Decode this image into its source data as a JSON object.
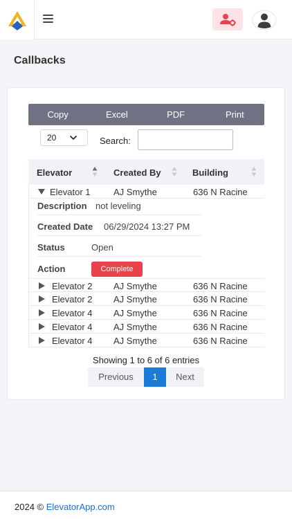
{
  "header": {
    "menu_icon": "hamburger-menu-icon",
    "admin_icon": "user-gear-icon",
    "profile_icon": "user-avatar-icon",
    "brand_colors": {
      "gold": "#f0b323",
      "blue": "#2563b8"
    }
  },
  "page": {
    "title": "Callbacks"
  },
  "toolbar": {
    "buttons": [
      "Copy",
      "Excel",
      "PDF",
      "Print"
    ],
    "length_value": "20",
    "search_label": "Search:",
    "search_value": ""
  },
  "table": {
    "columns": [
      "Elevator",
      "Created By",
      "Building"
    ],
    "expanded_row": {
      "elevator": "Elevator 1",
      "created_by": "AJ Smythe",
      "building": "636 N Racine"
    },
    "details": {
      "description_label": "Description",
      "description_value": "not leveling",
      "created_label": "Created Date",
      "created_value": "06/29/2024 13:27 PM",
      "status_label": "Status",
      "status_value": "Open",
      "action_label": "Action",
      "action_button": "Complete"
    },
    "rows": [
      {
        "elevator": "Elevator 2",
        "created_by": "AJ Smythe",
        "building": "636 N Racine"
      },
      {
        "elevator": "Elevator 2",
        "created_by": "AJ Smythe",
        "building": "636 N Racine"
      },
      {
        "elevator": "Elevator 4",
        "created_by": "AJ Smythe",
        "building": "636 N Racine"
      },
      {
        "elevator": "Elevator 4",
        "created_by": "AJ Smythe",
        "building": "636 N Racine"
      },
      {
        "elevator": "Elevator 4",
        "created_by": "AJ Smythe",
        "building": "636 N Racine"
      }
    ]
  },
  "pagination": {
    "info": "Showing 1 to 6 of 6 entries",
    "previous": "Previous",
    "current": "1",
    "next": "Next"
  },
  "footer": {
    "year": "2024 ©",
    "link": "ElevatorApp.com"
  },
  "colors": {
    "accent": "#1a7bd8",
    "danger": "#e9424b",
    "toolbar": "#6f7282"
  }
}
